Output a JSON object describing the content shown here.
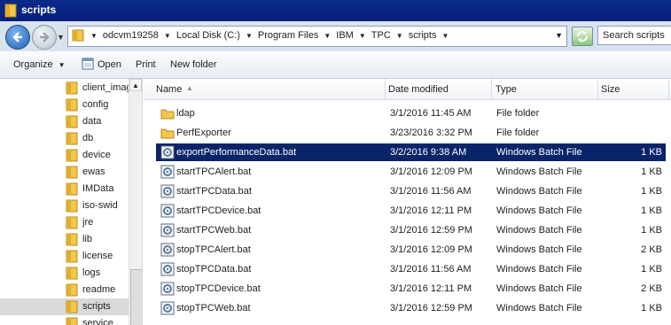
{
  "window": {
    "title": "scripts"
  },
  "address": {
    "crumbs": [
      "odcvm19258",
      "Local Disk (C:)",
      "Program Files",
      "IBM",
      "TPC",
      "scripts"
    ],
    "search_placeholder": "Search scripts"
  },
  "toolbar": {
    "organize": "Organize",
    "open": "Open",
    "print": "Print",
    "new_folder": "New folder"
  },
  "nav": {
    "items": [
      "client_imag",
      "config",
      "data",
      "db",
      "device",
      "ewas",
      "IMData",
      "iso-swid",
      "jre",
      "lib",
      "license",
      "logs",
      "readme",
      "scripts",
      "service"
    ],
    "selected": "scripts"
  },
  "columns": {
    "name": "Name",
    "date": "Date modified",
    "type": "Type",
    "size": "Size"
  },
  "files": [
    {
      "name": "ldap",
      "date": "3/1/2016 11:45 AM",
      "type": "File folder",
      "size": "",
      "icon": "folder-icon"
    },
    {
      "name": "PerfExporter",
      "date": "3/23/2016 3:32 PM",
      "type": "File folder",
      "size": "",
      "icon": "folder-icon"
    },
    {
      "name": "exportPerformanceData.bat",
      "date": "3/2/2016 9:38 AM",
      "type": "Windows Batch File",
      "size": "1 KB",
      "icon": "batch-file-icon"
    },
    {
      "name": "startTPCAlert.bat",
      "date": "3/1/2016 12:09 PM",
      "type": "Windows Batch File",
      "size": "1 KB",
      "icon": "batch-file-icon"
    },
    {
      "name": "startTPCData.bat",
      "date": "3/1/2016 11:56 AM",
      "type": "Windows Batch File",
      "size": "1 KB",
      "icon": "batch-file-icon"
    },
    {
      "name": "startTPCDevice.bat",
      "date": "3/1/2016 12:11 PM",
      "type": "Windows Batch File",
      "size": "1 KB",
      "icon": "batch-file-icon"
    },
    {
      "name": "startTPCWeb.bat",
      "date": "3/1/2016 12:59 PM",
      "type": "Windows Batch File",
      "size": "1 KB",
      "icon": "batch-file-icon"
    },
    {
      "name": "stopTPCAlert.bat",
      "date": "3/1/2016 12:09 PM",
      "type": "Windows Batch File",
      "size": "2 KB",
      "icon": "batch-file-icon"
    },
    {
      "name": "stopTPCData.bat",
      "date": "3/1/2016 11:56 AM",
      "type": "Windows Batch File",
      "size": "1 KB",
      "icon": "batch-file-icon"
    },
    {
      "name": "stopTPCDevice.bat",
      "date": "3/1/2016 12:11 PM",
      "type": "Windows Batch File",
      "size": "2 KB",
      "icon": "batch-file-icon"
    },
    {
      "name": "stopTPCWeb.bat",
      "date": "3/1/2016 12:59 PM",
      "type": "Windows Batch File",
      "size": "1 KB",
      "icon": "batch-file-icon"
    }
  ],
  "selected_file": "exportPerformanceData.bat",
  "colors": {
    "title_bar": "#0a2a8a",
    "selection": "#0a246a",
    "nav_selection": "#d9d9d9"
  }
}
